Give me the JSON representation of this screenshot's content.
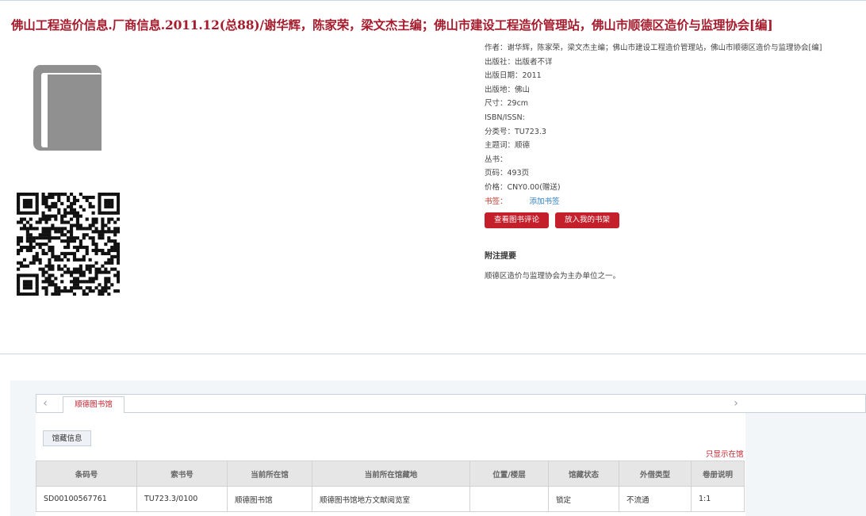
{
  "title": "佛山工程造价信息.厂商信息.2011.12(总88)/谢华辉，陈家荣，梁文杰主编；佛山市建设工程造价管理站，佛山市顺德区造价与监理协会[编]",
  "meta": {
    "author": "作者：谢华辉，陈家荣，梁文杰主编；佛山市建设工程造价管理站，佛山市顺德区造价与监理协会[编]",
    "publisher": "出版社：出版者不详",
    "pubdate": "出版日期：2011",
    "place": "出版地：佛山",
    "size": "尺寸：29cm",
    "isbn": "ISBN/ISSN:",
    "classno": "分类号：TU723.3",
    "subject": "主题词：顺德",
    "series": "丛书：",
    "pages": "页码：493页",
    "price": "价格：CNY0.00(赠送)",
    "tag_label": "书签：",
    "add_tag": "添加书签"
  },
  "buttons": {
    "review": "查看图书评论",
    "shelf": "放入我的书架"
  },
  "note": {
    "heading": "附注提要",
    "text": "顺德区造价与监理协会为主办单位之一。"
  },
  "tabs": {
    "prev": "‹",
    "next": "›",
    "active": "顺德图书馆"
  },
  "subtab": "馆藏信息",
  "only_link": "只显示在馆",
  "table": {
    "headers": [
      "条码号",
      "索书号",
      "当前所在馆",
      "当前所在馆藏地",
      "位置/楼层",
      "馆藏状态",
      "外借类型",
      "卷册说明"
    ],
    "rows": [
      [
        "SD00100567761",
        "TU723.3/0100",
        "顺德图书馆",
        "顺德图书馆地方文献阅览室",
        "",
        "锁定",
        "不流通",
        "1:1"
      ]
    ]
  }
}
